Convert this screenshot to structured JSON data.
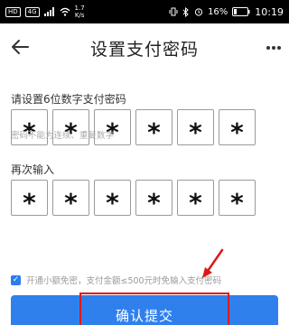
{
  "status_bar": {
    "left_badges": [
      "HD",
      "4G"
    ],
    "speed_value": "1.7",
    "speed_unit": "K/s",
    "battery": "16%",
    "time": "10:19"
  },
  "navbar": {
    "title": "设置支付密码"
  },
  "form": {
    "label_set": "请设置6位数字支付密码",
    "hint": "密码不能为连续、重复数字",
    "label_again": "再次输入",
    "pin1": [
      "*",
      "*",
      "*",
      "*",
      "*",
      "*"
    ],
    "pin2": [
      "*",
      "*",
      "*",
      "*",
      "*",
      "*"
    ]
  },
  "checkbox": {
    "checked": true,
    "text": "开通小额免密，支付金额≤500元时免输入支付密码"
  },
  "button": {
    "label": "确认提交"
  },
  "colors": {
    "accent": "#2f80ed",
    "annotation": "#e01818"
  }
}
